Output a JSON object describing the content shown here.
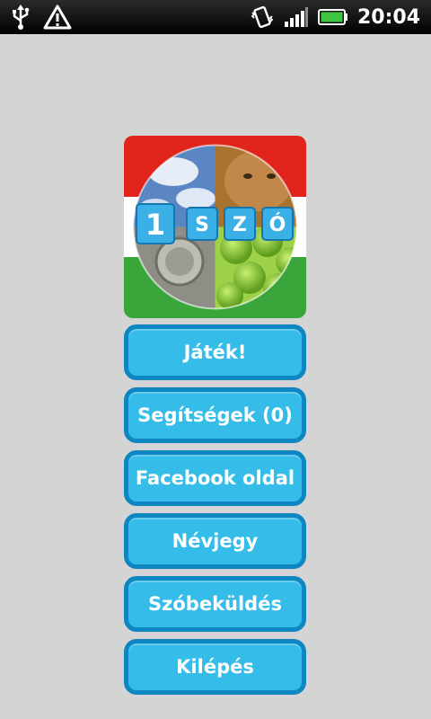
{
  "status_bar": {
    "time": "20:04",
    "icons": [
      "usb-icon",
      "warning-icon",
      "vibrate-icon",
      "signal-icon",
      "battery-icon"
    ],
    "battery_color": "#3ec43e"
  },
  "logo": {
    "letters": [
      "1",
      "S",
      "Z",
      "Ó"
    ],
    "flag_colors": [
      "#e0241c",
      "#ffffff",
      "#3aa53a"
    ]
  },
  "menu": {
    "play": "Játék!",
    "hints": "Segítségek (0)",
    "facebook": "Facebook oldal",
    "about": "Névjegy",
    "submit_word": "Szóbeküldés",
    "exit": "Kilépés"
  },
  "colors": {
    "background": "#d4d4d4",
    "button_fill": "#35bce8",
    "button_border": "#0d86c2"
  }
}
